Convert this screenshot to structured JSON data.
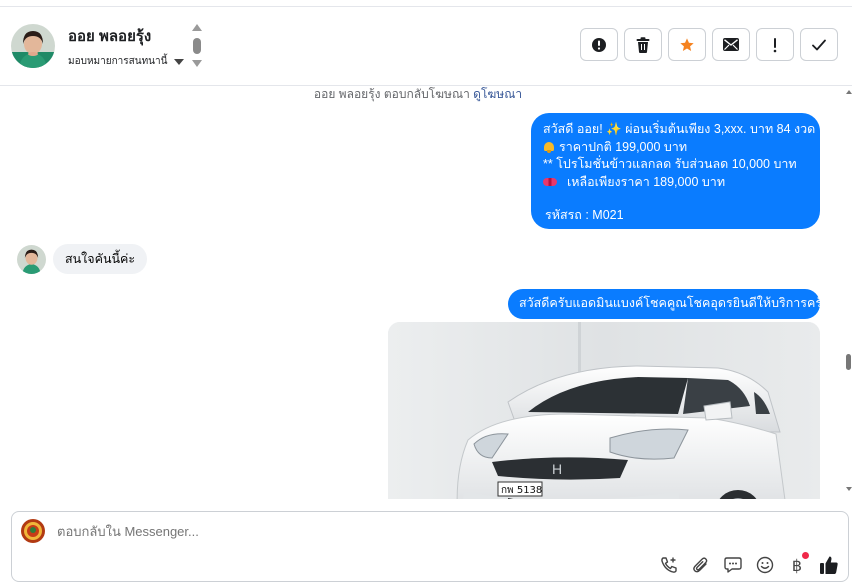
{
  "header": {
    "contact_name": "ออย พลอยรุ้ง",
    "assign_label": "มอบหมายการสนทนานี้",
    "actions": [
      {
        "name": "report-button",
        "icon": "alert-circle-icon"
      },
      {
        "name": "delete-button",
        "icon": "trash-icon"
      },
      {
        "name": "star-button",
        "icon": "star-icon"
      },
      {
        "name": "mark-unread-button",
        "icon": "envelope-icon"
      },
      {
        "name": "follow-up-button",
        "icon": "exclamation-icon"
      },
      {
        "name": "mark-done-button",
        "icon": "check-icon"
      }
    ]
  },
  "conversation": {
    "notice_prefix": "ออย พลอยรุ้ง ตอบกลับโฆษณา",
    "notice_link": "ดูโฆษณา",
    "messages": [
      {
        "direction": "outgoing",
        "lines": [
          "สวัสดี ออย! ✨  ผ่อนเริ่มต้นเพียง 3,xxx. บาท 84 งวด",
          "ราคาปกติ 199,000 บาท",
          "** โปรโมชั่นข้าวแลกลด รับส่วนลด 10,000 บาท",
          "เหลือเพียงราคา 189,000 บาท",
          "รหัสรถ : M021"
        ]
      },
      {
        "direction": "incoming",
        "text": "สนใจคันนี้ค่ะ"
      },
      {
        "direction": "outgoing",
        "text": "สวัสดีครับแอดมินแบงค์โชคคูณโชคอุดรยินดีให้บริการครับ"
      },
      {
        "direction": "outgoing",
        "type": "image",
        "plate": "กพ 5138"
      }
    ]
  },
  "composer": {
    "placeholder": "ตอบกลับใน Messenger...",
    "tools": [
      "phone-plus-icon",
      "paperclip-icon",
      "chat-bubble-icon",
      "smiley-icon",
      "baht-icon",
      "thumbs-up-icon"
    ],
    "baht_symbol": "฿"
  },
  "colors": {
    "outgoing_bubble": "#0a7cff",
    "incoming_bubble": "#f0f2f5",
    "star": "#f5821f"
  }
}
